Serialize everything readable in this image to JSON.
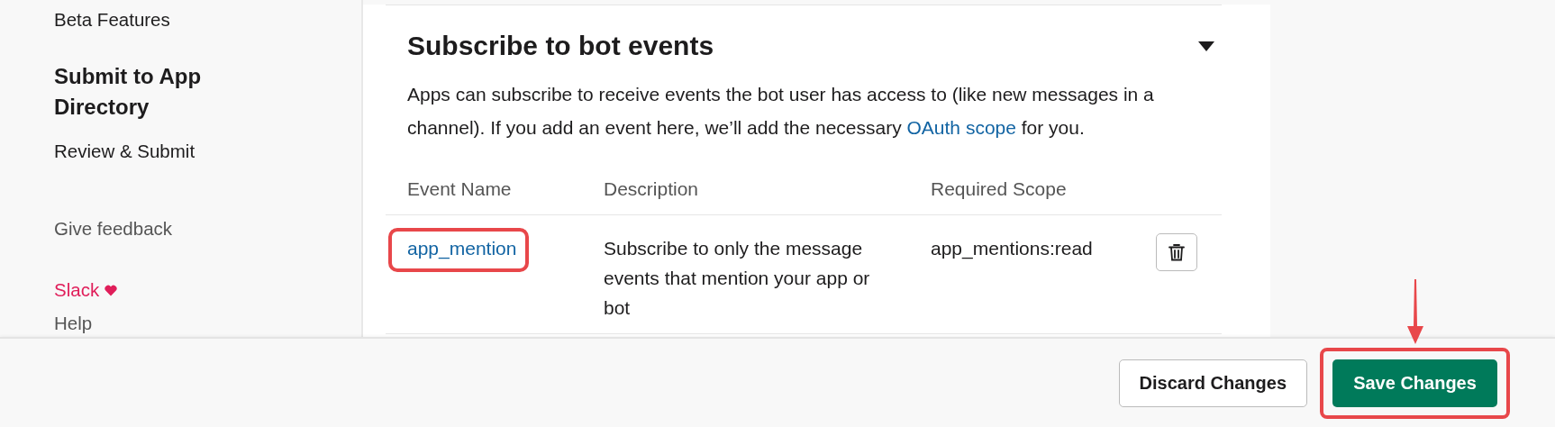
{
  "sidebar": {
    "items": [
      {
        "label": "Beta Features",
        "kind": "link"
      },
      {
        "label": "Submit to App Directory",
        "kind": "heading"
      },
      {
        "label": "Review & Submit",
        "kind": "link"
      }
    ],
    "feedback": "Give feedback",
    "footer_links": [
      {
        "label": "Slack",
        "kind": "brand"
      },
      {
        "label": "Help",
        "kind": "link"
      }
    ]
  },
  "section": {
    "title": "Subscribe to bot events",
    "expanded": true,
    "description": {
      "before": "Apps can subscribe to receive events the bot user has access to (like new messages in a channel). If you add an event here, we’ll add the necessary ",
      "link": "OAuth scope",
      "after": " for you."
    },
    "table": {
      "columns": [
        "Event Name",
        "Description",
        "Required Scope"
      ],
      "rows": [
        {
          "event": "app_mention",
          "description": "Subscribe to only the message events that mention your app or bot",
          "scope": "app_mentions:read",
          "highlighted": true
        }
      ]
    }
  },
  "footer": {
    "buttons": [
      {
        "label": "Discard Changes",
        "kind": "secondary",
        "highlighted": false
      },
      {
        "label": "Save Changes",
        "kind": "primary",
        "highlighted": true
      }
    ]
  }
}
